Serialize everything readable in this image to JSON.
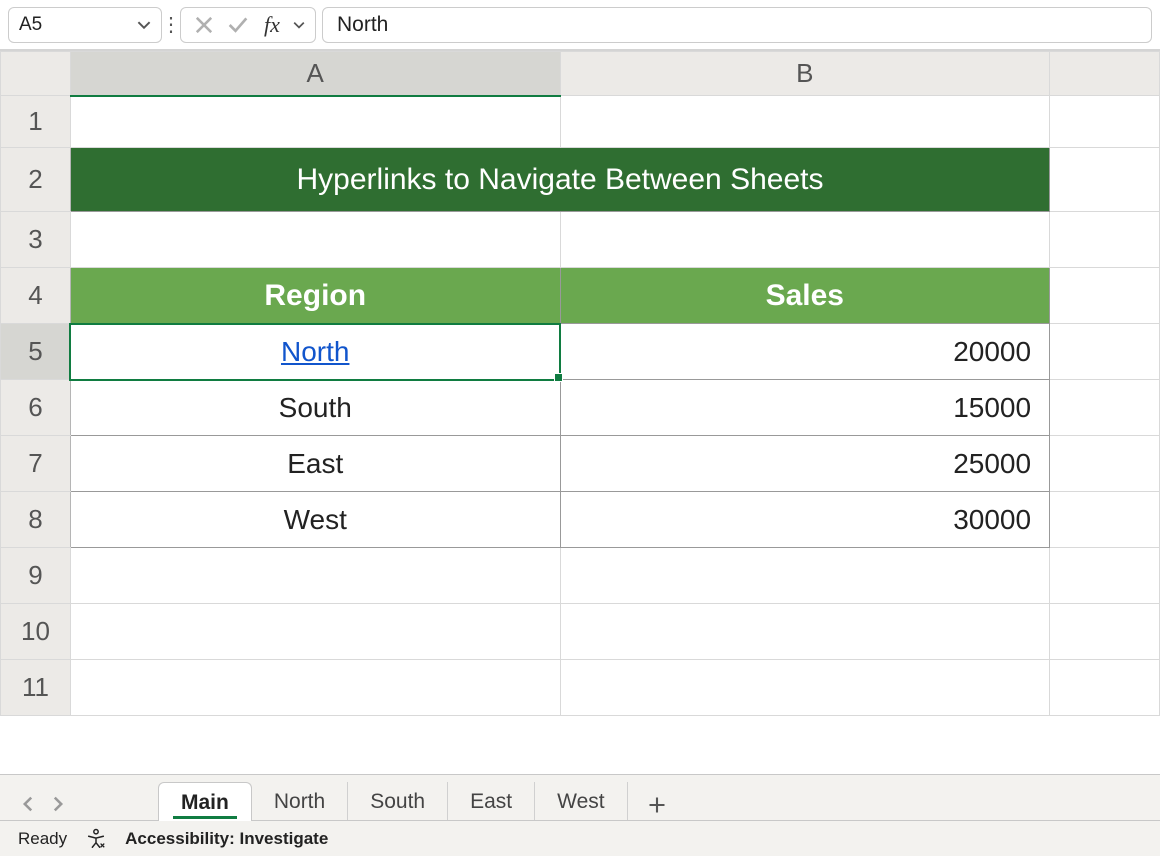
{
  "formula_bar": {
    "cell_ref": "A5",
    "value": "North",
    "fx_label": "fx"
  },
  "columns": [
    "A",
    "B"
  ],
  "row_numbers": [
    "1",
    "2",
    "3",
    "4",
    "5",
    "6",
    "7",
    "8",
    "9",
    "10",
    "11"
  ],
  "title": "Hyperlinks to Navigate Between Sheets",
  "headers": {
    "region": "Region",
    "sales": "Sales"
  },
  "rows": [
    {
      "region": "North",
      "sales": "20000",
      "link": true
    },
    {
      "region": "South",
      "sales": "15000",
      "link": false
    },
    {
      "region": "East",
      "sales": "25000",
      "link": false
    },
    {
      "region": "West",
      "sales": "30000",
      "link": false
    }
  ],
  "tabs": {
    "active": "Main",
    "items": [
      "Main",
      "North",
      "South",
      "East",
      "West"
    ]
  },
  "status": {
    "ready": "Ready",
    "accessibility": "Accessibility: Investigate"
  },
  "selected": {
    "row": 5,
    "col": "A"
  }
}
